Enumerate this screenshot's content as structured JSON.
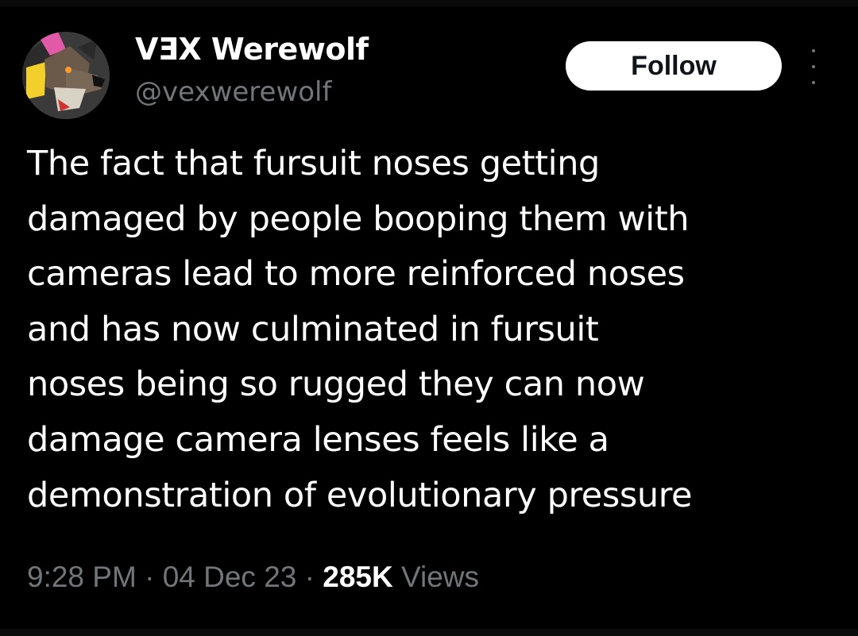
{
  "author": {
    "display_name": "VƎX Werewolf",
    "handle": "@vexwerewolf"
  },
  "actions": {
    "follow_label": "Follow",
    "more_icon": "more-vertical-icon"
  },
  "tweet": {
    "lines": [
      "The fact that fursuit noses getting",
      "damaged by people booping them with",
      "cameras lead to more reinforced noses",
      "and has now culminated in fursuit",
      "noses being so rugged they can now",
      "damage camera lenses feels like a",
      "demonstration of evolutionary pressure"
    ]
  },
  "meta": {
    "time": "9:28 PM",
    "separator": " · ",
    "date": "04 Dec 23",
    "views_count": "285K",
    "views_label": "Views"
  },
  "colors": {
    "background": "#000000",
    "text_primary": "#ffffff",
    "text_secondary": "#71767b",
    "follow_bg": "#ffffff",
    "follow_text": "#0f1419"
  }
}
